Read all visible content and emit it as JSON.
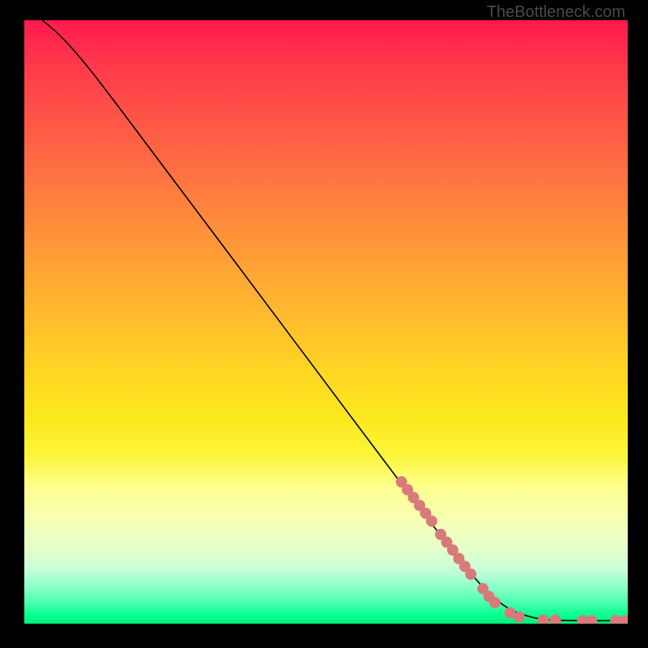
{
  "watermark": "TheBottleneck.com",
  "chart_data": {
    "type": "line",
    "title": "",
    "xlabel": "",
    "ylabel": "",
    "xlim": [
      0,
      100
    ],
    "ylim": [
      0,
      100
    ],
    "curve": {
      "description": "Monotonically decreasing curve from top-left to bottom-right; starts with slight convexity then nearly linear, flattening to zero near the right edge.",
      "points": [
        {
          "x": 3,
          "y": 100
        },
        {
          "x": 6,
          "y": 97.5
        },
        {
          "x": 10,
          "y": 93
        },
        {
          "x": 15,
          "y": 86.5
        },
        {
          "x": 20,
          "y": 79.8
        },
        {
          "x": 30,
          "y": 66.5
        },
        {
          "x": 40,
          "y": 53.2
        },
        {
          "x": 50,
          "y": 39.8
        },
        {
          "x": 60,
          "y": 26.5
        },
        {
          "x": 70,
          "y": 13.2
        },
        {
          "x": 78,
          "y": 3.5
        },
        {
          "x": 84,
          "y": 0.8
        },
        {
          "x": 90,
          "y": 0.5
        },
        {
          "x": 95,
          "y": 0.5
        },
        {
          "x": 99,
          "y": 0.5
        }
      ]
    },
    "highlighted_points": {
      "color": "#d97a7a",
      "radius": 7,
      "points": [
        {
          "x": 62.5,
          "y": 23.5
        },
        {
          "x": 63.5,
          "y": 22.2
        },
        {
          "x": 64.5,
          "y": 20.9
        },
        {
          "x": 65.5,
          "y": 19.6
        },
        {
          "x": 66.5,
          "y": 18.3
        },
        {
          "x": 67.5,
          "y": 17.0
        },
        {
          "x": 69.0,
          "y": 14.8
        },
        {
          "x": 70.0,
          "y": 13.5
        },
        {
          "x": 71.0,
          "y": 12.2
        },
        {
          "x": 72.0,
          "y": 10.8
        },
        {
          "x": 73.0,
          "y": 9.5
        },
        {
          "x": 74.0,
          "y": 8.2
        },
        {
          "x": 76.0,
          "y": 5.8
        },
        {
          "x": 77.0,
          "y": 4.5
        },
        {
          "x": 78.0,
          "y": 3.5
        },
        {
          "x": 80.5,
          "y": 1.8
        },
        {
          "x": 82.0,
          "y": 1.1
        },
        {
          "x": 86.0,
          "y": 0.6
        },
        {
          "x": 88.0,
          "y": 0.6
        },
        {
          "x": 92.5,
          "y": 0.5
        },
        {
          "x": 94.0,
          "y": 0.5
        },
        {
          "x": 98.0,
          "y": 0.5
        },
        {
          "x": 99.5,
          "y": 0.5
        }
      ]
    },
    "background_gradient": {
      "orientation": "vertical",
      "stops": [
        {
          "pos": 0,
          "color": "#ff1a4d"
        },
        {
          "pos": 50,
          "color": "#ffcc22"
        },
        {
          "pos": 75,
          "color": "#fdff60"
        },
        {
          "pos": 100,
          "color": "#00e878"
        }
      ]
    }
  }
}
